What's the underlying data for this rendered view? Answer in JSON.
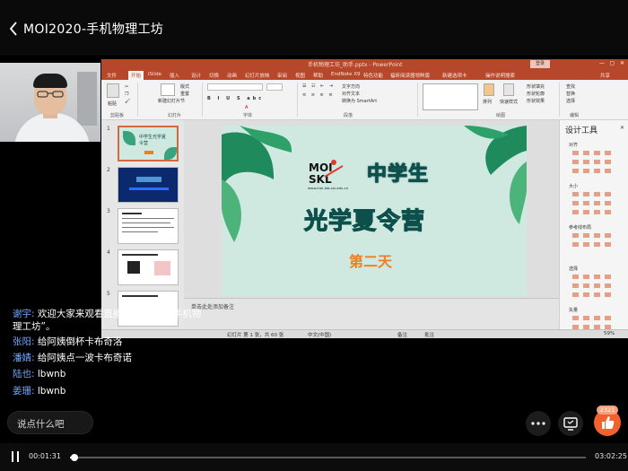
{
  "header": {
    "title": "MOI2020-手机物理工坊"
  },
  "ppt": {
    "window_title": "手机物理工坊_助手.pptx - PowerPoint",
    "login_label": "登录",
    "tabs": [
      "文件",
      "开始",
      "iSlide",
      "插入",
      "设计",
      "切换",
      "动画",
      "幻灯片放映",
      "审阅",
      "视图",
      "帮助",
      "EndNote X9",
      "特色功能",
      "福昕阅读器领鲜版",
      "新建选项卡",
      "操作说明搜索",
      "共享"
    ],
    "active_tab_index": 1,
    "ribbon_groups": [
      "剪贴板",
      "幻灯片",
      "字体",
      "段落",
      "绘图",
      "编辑"
    ],
    "ribbon_items": {
      "paste": "粘贴",
      "new_slide": "新建幻灯片",
      "layout": "版式",
      "reset": "重置",
      "section": "节",
      "find": "查找",
      "replace": "替换",
      "select": "选择",
      "arrange": "排列",
      "quick_styles": "快速样式",
      "shape_fill": "形状填充",
      "shape_outline": "形状轮廓",
      "shape_effect": "形状效果",
      "text_direction": "文字方向",
      "align_text": "对齐文本",
      "smartart": "转换为 SmartArt"
    },
    "thumbnails": [
      {
        "num": "1",
        "title": "中学生光学夏令营"
      },
      {
        "num": "2",
        "title": ""
      },
      {
        "num": "3",
        "title": ""
      },
      {
        "num": "4",
        "title": ""
      },
      {
        "num": "5",
        "title": ""
      }
    ],
    "slide": {
      "logo_text": "MOI SKL",
      "site": "www.moi-lab.zju.edu.cn",
      "title_line1": "中学生",
      "title_line2": "光学夏令营",
      "subtitle": "第二天"
    },
    "notes_placeholder": "单击此处添加备注",
    "design_pane": {
      "title": "设计工具",
      "sections": [
        "对齐",
        "大小",
        "参考线布局",
        "选择",
        "矢量"
      ]
    },
    "status": {
      "slide_count": "幻灯片 第 1 张，共 60 张",
      "language": "中文(中国)",
      "notes": "备注",
      "comments": "批注",
      "zoom": "59%"
    },
    "colors": {
      "ppt_accent": "#b7472a",
      "slide_bg": "#cfe8e0",
      "subtitle": "#ef7d22",
      "like": "#f2612e",
      "chat_user": "#6fa8ff"
    }
  },
  "chat": [
    {
      "user": "谢宇:",
      "text": " 欢迎大家来观看直播“MOI2020-手机物理工坊”。"
    },
    {
      "user": "张阳:",
      "text": " 给阿姨倒杯卡布奇洛"
    },
    {
      "user": "潘婧:",
      "text": " 给阿姨点一波卡布奇诺"
    },
    {
      "user": "陆也:",
      "text": " lbwnb"
    },
    {
      "user": "姜珊:",
      "text": " lbwnb"
    }
  ],
  "comment": {
    "placeholder": "说点什么吧"
  },
  "controls": {
    "more_icon": "more-dots-icon",
    "screen_icon": "screen-share-icon",
    "like_icon": "thumbs-up-icon",
    "like_count": "2321"
  },
  "player": {
    "current_time": "00:01:31",
    "total_time": "03:02:25",
    "progress": 0.0084
  }
}
